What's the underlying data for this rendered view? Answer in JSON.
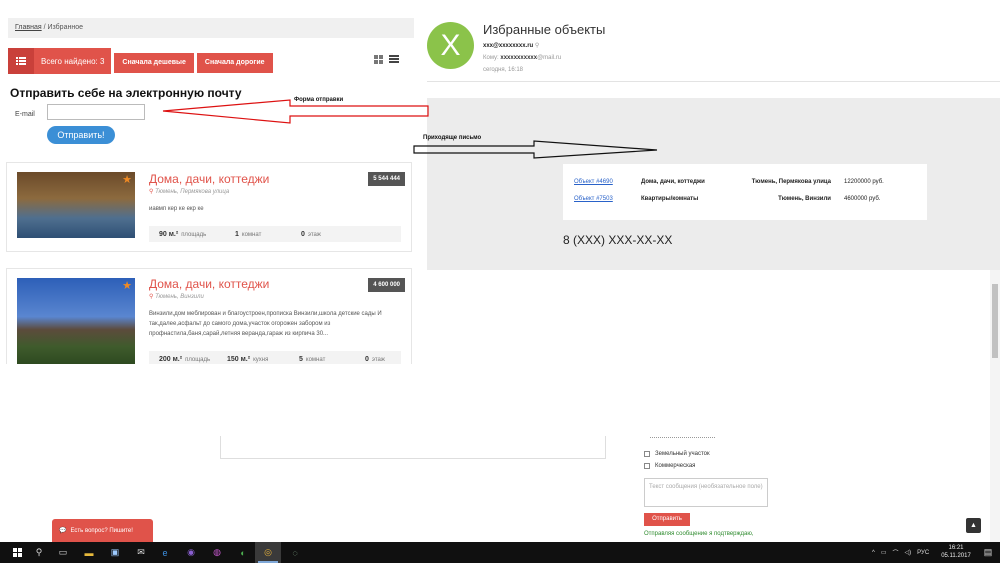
{
  "site": {
    "breadcrumb": {
      "home": "Главная",
      "sep": " / ",
      "current": "Избранное"
    },
    "found_label": "Всего найдено: 3",
    "sort_cheap": "Сначала дешевые",
    "sort_expensive": "Сначала дорогие",
    "send_title": "Отправить себе на электронную почту",
    "email_label": "E-mail",
    "send_button": "Отправить!"
  },
  "listings": [
    {
      "title": "Дома, дачи, коттеджи",
      "location": "Тюмень, Пермякова улица",
      "price": "5 544 444",
      "desc": "иавмп кер ке екр ке",
      "stats": [
        {
          "value": "90 м.²",
          "label": "площадь"
        },
        {
          "value": "1",
          "label": "комнат"
        },
        {
          "value": "0",
          "label": "этаж"
        }
      ]
    },
    {
      "title": "Дома, дачи, коттеджи",
      "location": "Тюмень, Винзили",
      "price": "4 600 000",
      "desc": "Винзили,дом меблирован и благоустроен,прописка Винзили,школа детские сады И так,далее,асфальт до самого дома,участок огорожен забором из профнастила,баня,сарай,летняя веранда,гараж из кирпича 30...",
      "stats": [
        {
          "value": "200 м.²",
          "label": "площадь"
        },
        {
          "value": "150 м.²",
          "label": "кухня"
        },
        {
          "value": "5",
          "label": "комнат"
        },
        {
          "value": "0",
          "label": "этаж"
        }
      ]
    }
  ],
  "annotations": {
    "form_label": "Форма отправки",
    "incoming_label": "Приходяще письмо"
  },
  "email": {
    "avatar_letter": "X",
    "subject": "Избранные объекты",
    "from": "xxx@xxxxxxxx.ru",
    "to_prefix": "Кому:",
    "to_name": "xxxxxxxxxxx",
    "to_domain": "@mail.ru",
    "date": "сегодня, 16:18",
    "rows": [
      {
        "link": "Объект #4690",
        "type": "Дома, дачи, коттеджи",
        "address": "Тюмень, Пермякова улица",
        "price": "12200000 руб."
      },
      {
        "link": "Объект #7503",
        "type": "Квартиры/комнаты",
        "address": "Тюмень, Винзили",
        "price": "4600000 руб."
      }
    ],
    "phone": "8 (XXX) XXX-XX-XX"
  },
  "form_bottom": {
    "checkbox_land": "Земельный участок",
    "checkbox_commercial": "Коммерческая",
    "message_placeholder": "Текст сообщения (необязательное поле)",
    "send": "Отправить",
    "note": "Отправляя сообщение я подтверждаю,"
  },
  "chat_button": "Есть вопрос? Пишите!",
  "taskbar": {
    "lang": "РУС",
    "time": "16:21",
    "date": "05.11.2017"
  },
  "colors": {
    "accent": "#e0534a",
    "link": "#2962c9",
    "avatar": "#8bc34a",
    "button_blue": "#3b8fd6"
  }
}
